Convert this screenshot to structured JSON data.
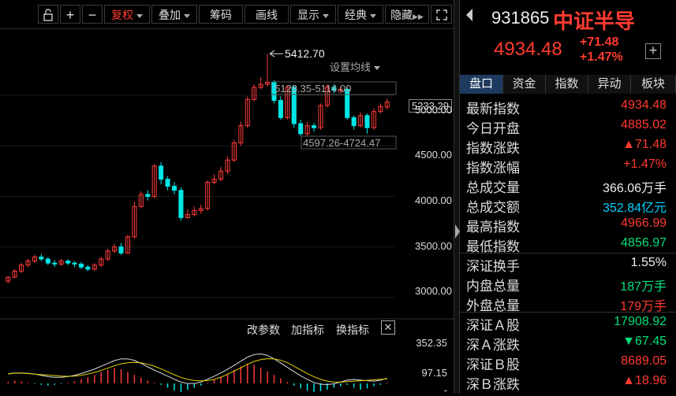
{
  "toolbar": {
    "plus": "+",
    "minus": "−",
    "fuquan": "复权",
    "diejia": "叠加",
    "chouma": "筹码",
    "huaxian": "画线",
    "xianshi": "显示",
    "jingdian": "经典",
    "yincang": "隐藏"
  },
  "main_chart": {
    "set_ma": "设置均线",
    "high_label": "5412.70",
    "box_label": "5128.35-5114.00",
    "box2_label": "4597.26-4724.47",
    "current_tag": "5233.29",
    "y_ticks": [
      "5000.00",
      "4500.00",
      "4000.00",
      "3500.00",
      "3000.00"
    ]
  },
  "sub_chart": {
    "gaicanshu": "改参数",
    "jiazhibiao": "加指标",
    "huanzhibiao": "换指标",
    "y_top": "352.35",
    "y_mid": "97.15",
    "y_bot": "-"
  },
  "quote": {
    "code": "931865",
    "name": "中证半导",
    "price": "4934.48",
    "change": "+71.48",
    "change_pct": "+1.47%"
  },
  "tabs": [
    "盘口",
    "资金",
    "指数",
    "异动",
    "板块"
  ],
  "stats": [
    {
      "label": "最新指数",
      "value": "4934.48",
      "color": "red"
    },
    {
      "label": "今日开盘",
      "value": "4885.02",
      "color": "red"
    },
    {
      "label": "指数涨跌",
      "value": "▲71.48",
      "color": "red"
    },
    {
      "label": "指数涨幅",
      "value": "+1.47%",
      "color": "red"
    },
    {
      "label": "总成交量",
      "value": "366.06万手",
      "color": "white"
    },
    {
      "label": "总成交额",
      "value": "352.84亿元",
      "color": "cyan"
    },
    {
      "label": "最高指数",
      "value": "4966.99",
      "color": "red"
    },
    {
      "label": "最低指数",
      "value": "4856.97",
      "color": "green"
    },
    {
      "label": "深证换手",
      "value": "1.55%",
      "color": "white"
    },
    {
      "label": "内盘总量",
      "value": "187万手",
      "color": "green"
    },
    {
      "label": "外盘总量",
      "value": "179万手",
      "color": "red"
    },
    {
      "label": "深证Ａ股",
      "value": "17908.92",
      "color": "green"
    },
    {
      "label": "深Ａ涨跌",
      "value": "▼67.45",
      "color": "green"
    },
    {
      "label": "深证Ｂ股",
      "value": "8689.05",
      "color": "red"
    },
    {
      "label": "深Ｂ涨跌",
      "value": "▲18.96",
      "color": "red"
    }
  ],
  "chart_data": {
    "type": "candlestick",
    "ylim": [
      2850,
      5500
    ],
    "candles": [
      [
        3160,
        3200,
        3140,
        3210
      ],
      [
        3200,
        3260,
        3190,
        3280
      ],
      [
        3260,
        3320,
        3240,
        3340
      ],
      [
        3320,
        3360,
        3300,
        3380
      ],
      [
        3360,
        3400,
        3340,
        3420
      ],
      [
        3400,
        3380,
        3360,
        3430
      ],
      [
        3380,
        3340,
        3320,
        3400
      ],
      [
        3340,
        3330,
        3300,
        3370
      ],
      [
        3330,
        3360,
        3310,
        3380
      ],
      [
        3360,
        3340,
        3320,
        3380
      ],
      [
        3340,
        3330,
        3300,
        3360
      ],
      [
        3330,
        3300,
        3280,
        3350
      ],
      [
        3300,
        3280,
        3260,
        3320
      ],
      [
        3280,
        3320,
        3260,
        3340
      ],
      [
        3320,
        3380,
        3300,
        3400
      ],
      [
        3380,
        3460,
        3360,
        3480
      ],
      [
        3460,
        3500,
        3440,
        3530
      ],
      [
        3500,
        3440,
        3420,
        3540
      ],
      [
        3440,
        3600,
        3430,
        3620
      ],
      [
        3600,
        3900,
        3580,
        3950
      ],
      [
        3900,
        4020,
        3880,
        4050
      ],
      [
        4020,
        4000,
        3960,
        4060
      ],
      [
        4000,
        4300,
        3980,
        4320
      ],
      [
        4300,
        4170,
        4120,
        4340
      ],
      [
        4170,
        4100,
        4060,
        4200
      ],
      [
        4100,
        4060,
        4020,
        4140
      ],
      [
        4060,
        3790,
        3760,
        4090
      ],
      [
        3790,
        3820,
        3780,
        3870
      ],
      [
        3820,
        3860,
        3800,
        3900
      ],
      [
        3860,
        3880,
        3830,
        3920
      ],
      [
        3880,
        4140,
        3860,
        4160
      ],
      [
        4140,
        4170,
        4120,
        4220
      ],
      [
        4170,
        4250,
        4150,
        4290
      ],
      [
        4250,
        4360,
        4220,
        4400
      ],
      [
        4360,
        4530,
        4340,
        4560
      ],
      [
        4530,
        4700,
        4500,
        4740
      ],
      [
        4700,
        4960,
        4680,
        4990
      ],
      [
        4960,
        5080,
        4940,
        5110
      ],
      [
        5080,
        5110,
        5060,
        5180
      ],
      [
        5110,
        5130,
        5090,
        5412.7
      ],
      [
        5130,
        4950,
        4920,
        5150
      ],
      [
        4950,
        4780,
        4760,
        4990
      ],
      [
        4780,
        5080,
        4760,
        5100
      ],
      [
        5080,
        4720,
        4680,
        5100
      ],
      [
        4720,
        4620,
        4597,
        4760
      ],
      [
        4620,
        4700,
        4600,
        4740
      ],
      [
        4700,
        4680,
        4640,
        4730
      ],
      [
        4680,
        4900,
        4660,
        4920
      ],
      [
        4900,
        5080,
        4880,
        5110
      ],
      [
        5080,
        5050,
        5020,
        5110
      ],
      [
        5050,
        5060,
        5020,
        5090
      ],
      [
        5060,
        4780,
        4760,
        5080
      ],
      [
        4780,
        4700,
        4660,
        4800
      ],
      [
        4700,
        4800,
        4680,
        4830
      ],
      [
        4800,
        4680,
        4620,
        4820
      ],
      [
        4680,
        4840,
        4660,
        4870
      ],
      [
        4840,
        4890,
        4820,
        4920
      ],
      [
        4885,
        4934,
        4857,
        4967
      ]
    ],
    "macd_hist": [
      10,
      20,
      15,
      5,
      -5,
      -10,
      -15,
      -10,
      -5,
      5,
      15,
      30,
      45,
      60,
      80,
      95,
      110,
      100,
      80,
      60,
      40,
      20,
      5,
      -10,
      -30,
      -50,
      -60,
      -45,
      -30,
      -15,
      5,
      25,
      45,
      70,
      95,
      120,
      140,
      130,
      110,
      85,
      60,
      35,
      10,
      -15,
      -35,
      -50,
      -60,
      -55,
      -45,
      -30,
      -20,
      -10,
      -30,
      -45,
      -35,
      -20,
      -10,
      5
    ]
  }
}
